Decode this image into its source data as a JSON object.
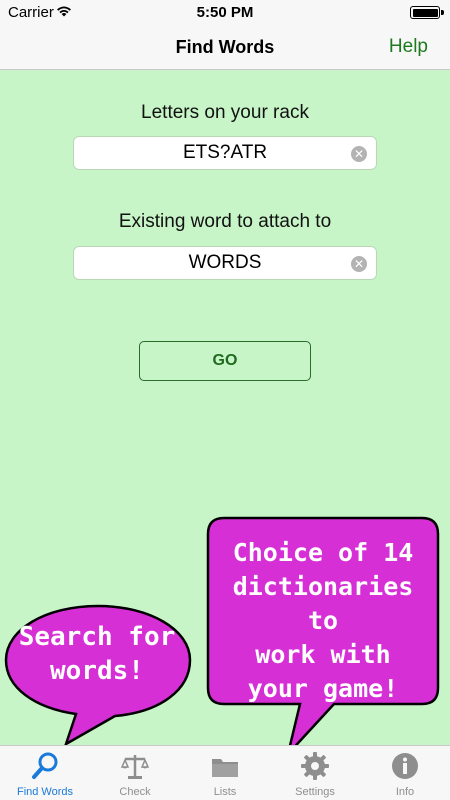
{
  "status_bar": {
    "carrier": "Carrier",
    "time": "5:50 PM"
  },
  "nav": {
    "title": "Find Words",
    "help": "Help"
  },
  "rack": {
    "label": "Letters on your rack",
    "value": "ETS?ATR"
  },
  "attach": {
    "label": "Existing word to attach to",
    "value": "WORDS"
  },
  "go_label": "GO",
  "callouts": {
    "left": [
      "Search for",
      "words!"
    ],
    "right": [
      "Choice of 14",
      "dictionaries to",
      "work with",
      "your game!"
    ]
  },
  "tabs": [
    {
      "label": "Find Words",
      "icon": "magnifier-icon",
      "active": true
    },
    {
      "label": "Check",
      "icon": "scales-icon",
      "active": false
    },
    {
      "label": "Lists",
      "icon": "folder-icon",
      "active": false
    },
    {
      "label": "Settings",
      "icon": "gear-icon",
      "active": false
    },
    {
      "label": "Info",
      "icon": "info-icon",
      "active": false
    }
  ],
  "colors": {
    "background": "#c8f5c8",
    "accent_green": "#1f7a1f",
    "callout_fill": "#d62fd6",
    "tab_active": "#1a7ad9",
    "tab_inactive": "#8e8e8e"
  }
}
